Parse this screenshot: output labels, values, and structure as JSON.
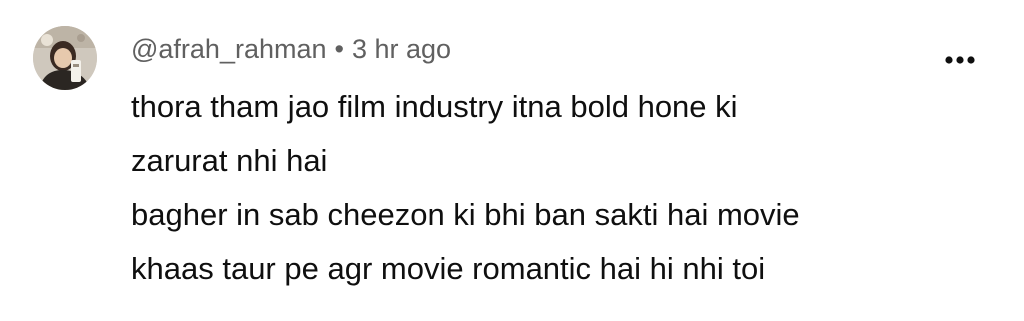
{
  "comment": {
    "username": "@afrah_rahman",
    "separator": "•",
    "time": "3 hr ago",
    "lines": [
      "thora tham jao film industry itna bold hone ki",
      "zarurat nhi hai",
      "bagher in sab cheezon ki bhi ban sakti hai movie",
      "khaas taur pe agr movie romantic hai hi nhi toi"
    ],
    "avatar_icon": "profile-photo",
    "menu_icon": "more-horizontal-icon"
  }
}
